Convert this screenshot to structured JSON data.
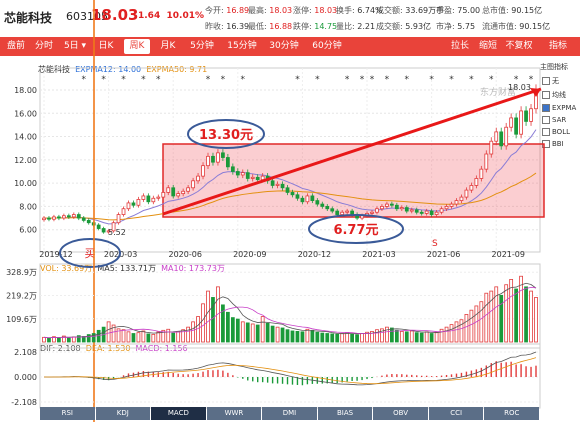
{
  "quote": {
    "name": "芯能科技",
    "code": "603105",
    "price": "18.03",
    "change": "1.64",
    "change_pct": "10.01%",
    "fields": [
      {
        "label": "今开:",
        "value": "16.89",
        "color": "#e02020"
      },
      {
        "label": "最高:",
        "value": "18.03",
        "color": "#e02020"
      },
      {
        "label": "涨停:",
        "value": "18.03",
        "color": "#e02020"
      },
      {
        "label": "换手:",
        "value": "6.74%",
        "color": "#333333"
      },
      {
        "label": "成交额:",
        "value": "33.69万手",
        "color": "#333333"
      },
      {
        "label": "市盈:",
        "value": "75.00",
        "color": "#333333"
      },
      {
        "label": "总市值:",
        "value": "90.15亿",
        "color": "#333333"
      },
      {
        "label": "昨收:",
        "value": "16.39",
        "color": "#333333"
      },
      {
        "label": "最低:",
        "value": "16.88",
        "color": "#e02020"
      },
      {
        "label": "跌停:",
        "value": "14.75",
        "color": "#1a9a3a"
      },
      {
        "label": "量比:",
        "value": "2.21",
        "color": "#333333"
      },
      {
        "label": "成交额:",
        "value": "5.93亿",
        "color": "#333333"
      },
      {
        "label": "市净:",
        "value": "5.75",
        "color": "#333333"
      },
      {
        "label": "流通市值:",
        "value": "90.15亿",
        "color": "#333333"
      }
    ]
  },
  "tabs": [
    "盘前",
    "分时",
    "5日 ▾",
    "日K",
    "周K",
    "月K",
    "5分钟",
    "15分钟",
    "30分钟",
    "60分钟"
  ],
  "active_tab": "周K",
  "toolbar_right": [
    "拉长",
    "缩短",
    "不复权 ▾",
    "指标"
  ],
  "price_legend": {
    "title": "芯能科技",
    "ema12": "EXPMA12: 14.00",
    "ema50": "EXPMA50: 9.71"
  },
  "vol_legend": {
    "vol": "VOL: 33.69万",
    "ma5": "MA5: 133.71万",
    "ma10": "MA10: 173.73万"
  },
  "macd_legend": {
    "dif": "DIF: 2.108",
    "dea": "DEA: 1.530",
    "macd": "MACD: 1.156"
  },
  "side_panel": {
    "title": "主图指标",
    "items": [
      "无",
      "均线",
      "EXPMA",
      "SAR",
      "BOLL",
      "BBI"
    ],
    "selected": "EXPMA"
  },
  "indicators": [
    "RSI",
    "KDJ",
    "MACD",
    "WWR",
    "DMI",
    "BIAS",
    "OBV",
    "CCI",
    "ROC"
  ],
  "active_indicator": "MACD",
  "watermark": "东方财富",
  "annotations": {
    "high_label": "13.30元",
    "low_label": "6.77元",
    "start_label": "5.52",
    "peak_label": "18.03",
    "s_marker": "S",
    "buy_marker": "买"
  },
  "chart_data": {
    "type": "candlestick",
    "y_ticks": [
      6,
      8,
      10,
      12,
      14,
      16,
      18
    ],
    "ylim": [
      4.6,
      19.2
    ],
    "x_ticks": [
      "2019-12",
      "2020-03",
      "2020-06",
      "2020-09",
      "2020-12",
      "2021-03",
      "2021-06",
      "2021-09"
    ],
    "x_tick_index": [
      0,
      13,
      26,
      39,
      52,
      65,
      78,
      91
    ],
    "weeks": 100,
    "close": [
      7.0,
      6.9,
      7.1,
      7.0,
      7.2,
      7.1,
      7.3,
      7.0,
      6.8,
      6.6,
      6.4,
      6.1,
      5.8,
      5.9,
      6.6,
      7.3,
      7.8,
      8.3,
      8.1,
      8.6,
      8.9,
      8.4,
      8.7,
      8.8,
      9.2,
      9.6,
      8.9,
      9.1,
      9.3,
      9.6,
      10.2,
      10.6,
      11.5,
      12.3,
      11.8,
      12.6,
      12.2,
      11.4,
      11.0,
      10.7,
      10.9,
      10.4,
      10.5,
      10.3,
      10.6,
      10.2,
      9.8,
      9.9,
      9.6,
      9.2,
      9.0,
      8.7,
      8.4,
      8.9,
      8.5,
      8.2,
      8.0,
      7.8,
      7.6,
      7.3,
      7.5,
      7.6,
      7.3,
      7.0,
      7.2,
      7.4,
      7.5,
      7.8,
      8.0,
      8.2,
      8.1,
      7.8,
      7.9,
      7.6,
      7.7,
      7.5,
      7.4,
      7.6,
      7.3,
      7.5,
      7.8,
      8.0,
      8.2,
      8.5,
      8.8,
      9.4,
      9.8,
      10.4,
      11.2,
      12.5,
      13.6,
      14.4,
      13.2,
      14.8,
      15.6,
      14.2,
      16.2,
      15.3,
      16.39,
      18.03
    ],
    "ema12_last": 14.0,
    "ema50_last": 9.71,
    "volume_ticks": [
      "328.9万",
      "219.2万",
      "109.6万"
    ],
    "volume_ylim": [
      0,
      330
    ],
    "volume": [
      22,
      18,
      25,
      20,
      28,
      19,
      24,
      30,
      26,
      35,
      40,
      55,
      70,
      95,
      80,
      62,
      58,
      48,
      40,
      44,
      52,
      38,
      36,
      47,
      55,
      60,
      42,
      50,
      58,
      70,
      95,
      120,
      180,
      240,
      210,
      260,
      175,
      140,
      115,
      108,
      95,
      90,
      85,
      80,
      120,
      88,
      75,
      70,
      66,
      58,
      52,
      50,
      48,
      60,
      55,
      46,
      42,
      40,
      38,
      36,
      40,
      45,
      38,
      34,
      40,
      46,
      50,
      58,
      62,
      70,
      66,
      55,
      50,
      48,
      52,
      44,
      42,
      48,
      40,
      46,
      60,
      70,
      82,
      95,
      105,
      130,
      150,
      170,
      190,
      230,
      240,
      260,
      220,
      270,
      295,
      250,
      310,
      260,
      240,
      210
    ],
    "ma5_last": 133.71,
    "ma10_last": 173.73,
    "macd_ticks": [
      2.108,
      0,
      -2.108
    ],
    "macd_ylim": [
      -2.108,
      2.108
    ],
    "dif_last": 2.108,
    "dea_last": 1.53,
    "macd_last": 1.156
  }
}
